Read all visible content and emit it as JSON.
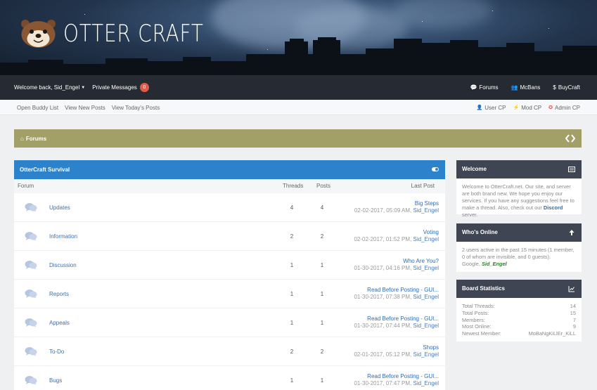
{
  "brand": {
    "name": "OTTER CRAFT"
  },
  "topnav": {
    "welcome": "Welcome back, Sid_Engel",
    "private_messages": "Private Messages",
    "pm_count": "0",
    "links": [
      {
        "label": "Forums",
        "icon": "comments-icon"
      },
      {
        "label": "McBans",
        "icon": "users-icon"
      },
      {
        "label": "BuyCraft",
        "icon": "dollar-icon"
      }
    ]
  },
  "subnav": {
    "left": [
      "Open Buddy List",
      "View New Posts",
      "View Today's Posts"
    ],
    "right": [
      {
        "label": "User CP",
        "icon": "user-icon",
        "color": "#666666"
      },
      {
        "label": "Mod CP",
        "icon": "bolt-icon",
        "color": "#f0a020"
      },
      {
        "label": "Admin CP",
        "icon": "admin-icon",
        "color": "#e04a3a"
      }
    ]
  },
  "breadcrumb": {
    "label": "Forums",
    "icon": "home-icon"
  },
  "forum": {
    "title": "OtterCraft Survival",
    "columns": {
      "forum": "Forum",
      "threads": "Threads",
      "posts": "Posts",
      "last_post": "Last Post"
    },
    "rows": [
      {
        "name": "Updates",
        "threads": "4",
        "posts": "4",
        "last_title": "Big Steps",
        "last_date": "02-02-2017, 05:09 AM,",
        "last_user": "Sid_Engel"
      },
      {
        "name": "Information",
        "threads": "2",
        "posts": "2",
        "last_title": "Voting",
        "last_date": "02-02-2017, 01:52 PM,",
        "last_user": "Sid_Engel"
      },
      {
        "name": "Discussion",
        "threads": "1",
        "posts": "1",
        "last_title": "Who Are You?",
        "last_date": "01-30-2017, 04:16 PM,",
        "last_user": "Sid_Engel"
      },
      {
        "name": "Reports",
        "threads": "1",
        "posts": "1",
        "last_title": "Read Before Posting - GUI...",
        "last_date": "01-30-2017, 07:38 PM,",
        "last_user": "Sid_Engel"
      },
      {
        "name": "Appeals",
        "threads": "1",
        "posts": "1",
        "last_title": "Read Before Posting - GUI...",
        "last_date": "01-30-2017, 07:44 PM,",
        "last_user": "Sid_Engel"
      },
      {
        "name": "To-Do",
        "threads": "2",
        "posts": "2",
        "last_title": "Shops",
        "last_date": "02-01-2017, 05:12 PM,",
        "last_user": "Sid_Engel"
      },
      {
        "name": "Bugs",
        "threads": "1",
        "posts": "1",
        "last_title": "Read Before Posting - GUI...",
        "last_date": "01-30-2017, 07:47 PM,",
        "last_user": "Sid_Engel"
      }
    ]
  },
  "sidebar": {
    "welcome": {
      "title": "Welcome",
      "text": "Welcome to OtterCraft.net. Our site, and server are both brand new. We hope you enjoy our services. If you have any suggestions feel free to make a thread. Also, check out our",
      "link": "Discord",
      "tail": "server."
    },
    "online": {
      "title": "Who's Online",
      "text": "2 users active in the past 15 minutes (1 member, 0 of whom are invisible, and 0 guests).",
      "members_prefix": "Google,",
      "member": "Sid_Engel"
    },
    "stats": {
      "title": "Board Statistics",
      "items": [
        {
          "label": "Total Threads:",
          "value": "14"
        },
        {
          "label": "Total Posts:",
          "value": "15"
        },
        {
          "label": "Members:",
          "value": "7"
        },
        {
          "label": "Most Online:",
          "value": "9"
        },
        {
          "label": "Newest Member:",
          "value": "MoBaNgKiLlEr_KiLL"
        }
      ]
    }
  },
  "colors": {
    "topnav_bg": "#262b33",
    "breadcrumb_bg": "#a29f67",
    "forum_header_bg": "#2c83cb",
    "sidebar_header_bg": "#3f4553",
    "pm_badge": "#e15b4a"
  }
}
